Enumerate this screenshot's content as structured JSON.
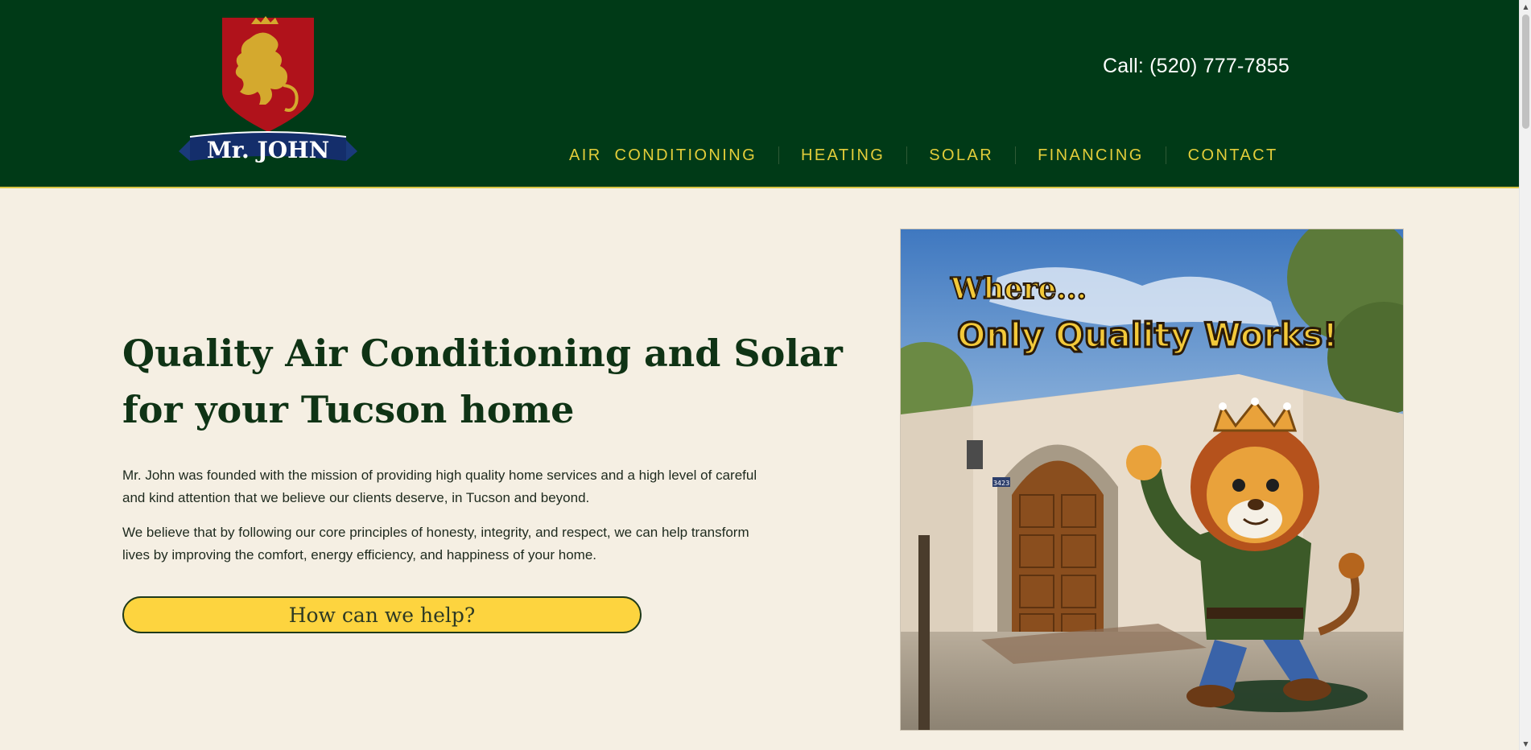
{
  "header": {
    "logo_text": "Mr. JOHN",
    "phone": "Call: (520) 777-7855"
  },
  "nav": {
    "items": [
      {
        "label": "AIR  CONDITIONING"
      },
      {
        "label": "HEATING"
      },
      {
        "label": "SOLAR"
      },
      {
        "label": "FINANCING"
      },
      {
        "label": "CONTACT"
      }
    ]
  },
  "hero": {
    "title": "Quality Air Conditioning and Solar for your Tucson home",
    "paragraph_1": "Mr. John was founded with the mission of providing high quality home services and a high level of careful and kind attention that we believe our clients deserve, in Tucson and beyond.",
    "paragraph_2": "We believe that by following our core principles of honesty, integrity, and respect, we can help transform lives by improving the comfort, energy efficiency, and happiness of your home.",
    "cta_label": "How can we help?"
  },
  "hero_image": {
    "line_1": "Where...",
    "line_2": "Only Quality Works!",
    "house_number": "3423"
  },
  "colors": {
    "header_bg": "#003a17",
    "nav_text": "#e3cd3a",
    "page_bg": "#f5efe3",
    "title": "#0f3315",
    "cta_bg": "#fdd43f"
  },
  "icons": {
    "scroll_up": "triangle-up-icon",
    "scroll_down": "triangle-down-icon"
  }
}
